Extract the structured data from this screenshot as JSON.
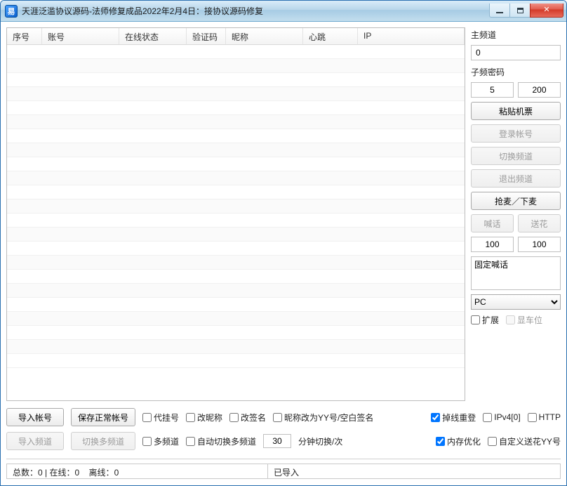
{
  "window": {
    "title": "天涯泛滥协议源码-法师修复成品2022年2月4日：接协议源码修复",
    "icon_glyph": "易"
  },
  "table": {
    "columns": [
      "序号",
      "账号",
      "在线状态",
      "验证码",
      "昵称",
      "心跳",
      "IP"
    ],
    "rows": []
  },
  "sidebar": {
    "main_channel_label": "主频道",
    "main_channel_value": "0",
    "sub_pwd_label": "子频密码",
    "sub_val_a": "5",
    "sub_val_b": "200",
    "btn_paste_ticket": "粘贴机票",
    "btn_login": "登录帐号",
    "btn_switch_channel": "切换频道",
    "btn_exit_channel": "退出频道",
    "btn_grab_mic": "抢麦／下麦",
    "btn_shout": "喊话",
    "btn_flower": "送花",
    "val_a": "100",
    "val_b": "100",
    "fixed_shout_text": "固定喊话",
    "device_select": "PC",
    "chk_expand": "扩展",
    "chk_show_station": "显车位"
  },
  "controls": {
    "btn_import_account": "导入帐号",
    "btn_save_normal_account": "保存正常帐号",
    "btn_import_channel": "导入频道",
    "btn_switch_multi_channel": "切换多频道",
    "chk_proxy_account": "代挂号",
    "chk_change_nick": "改昵称",
    "chk_change_sign": "改签名",
    "chk_nick_to_yy": "昵称改为YY号/空白签名",
    "chk_offline_relogin": "掉线重登",
    "chk_ipv4": "IPv4[0]",
    "chk_http": "HTTP",
    "chk_multi_channel": "多频道",
    "chk_auto_switch_multi": "自动切换多频道",
    "interval_value": "30",
    "interval_suffix": "分钟切换/次",
    "chk_mem_opt": "内存优化",
    "chk_custom_flower_yy": "自定义送花YY号"
  },
  "status": {
    "total_label": "总数：",
    "total_value": "0",
    "sep": "  |  ",
    "online_label": "在线：",
    "online_value": "0",
    "offline_label": "离线：",
    "offline_value": "0",
    "right_text": "已导入"
  }
}
